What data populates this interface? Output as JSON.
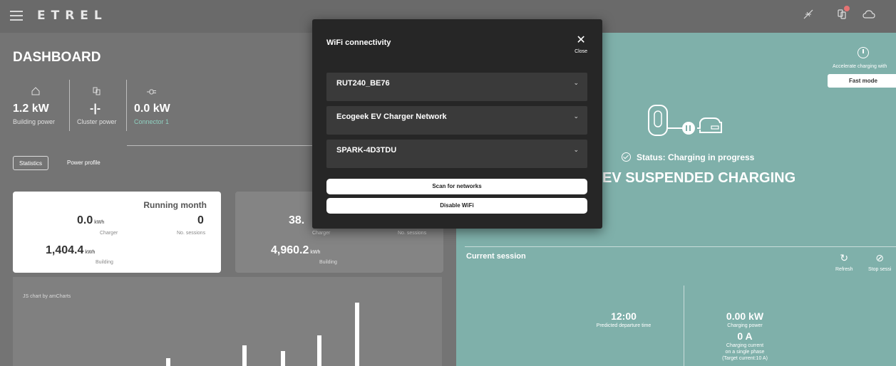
{
  "topbar": {
    "logo": "ETREL",
    "icons": [
      "menu-icon",
      "solar-off-icon",
      "cluster-icon",
      "cloud-icon"
    ]
  },
  "dashboard": {
    "title": "DASHBOARD",
    "power": [
      {
        "value": "1.2 kW",
        "label": "Building power",
        "icon": "home-icon"
      },
      {
        "value": "-|-",
        "label": "Cluster power",
        "icon": "cluster-icon"
      },
      {
        "value": "0.0 kW",
        "label": "Connector 1",
        "icon": "plug-icon"
      }
    ],
    "tabs": [
      "Statistics",
      "Power profile"
    ],
    "card_month": {
      "title": "Running month",
      "charger_value": "0.0",
      "charger_unit": "kWh",
      "charger_label": "Charger",
      "sessions_value": "0",
      "sessions_label": "No. sessions",
      "building_value": "1,404.4",
      "building_unit": "kWh",
      "building_label": "Building"
    },
    "card_other": {
      "charger_value": "38.",
      "charger_label": "Charger",
      "sessions_label": "No. sessions",
      "building_value": "4,960.2",
      "building_unit": "kWh",
      "building_label": "Building"
    },
    "chart_credit": "JS chart by amCharts"
  },
  "charger_panel": {
    "accelerate_label": "Accelerate charging with",
    "fast_mode": "Fast mode",
    "status": "Status: Charging in progress",
    "state_title": "EV SUSPENDED CHARGING",
    "current_session": "Current session",
    "refresh": "Refresh",
    "stop_session": "Stop sessi",
    "departure_value": "12:00",
    "departure_label": "Predicted departure time",
    "power_value": "0.00 kW",
    "power_label": "Charging power",
    "current_value": "0 A",
    "current_label_1": "Charging current",
    "current_label_2": "on a single phase",
    "current_label_3": "(Target current:10 A)"
  },
  "wifi_modal": {
    "title": "WiFi connectivity",
    "close": "Close",
    "networks": [
      "RUT240_BE76",
      "Ecogeek EV Charger Network",
      "SPARK-4D3TDU"
    ],
    "scan": "Scan for networks",
    "disable": "Disable WiFi"
  },
  "colors": {
    "background": "#747474",
    "panel_teal": "#7fb0aa",
    "modal_bg": "#262626",
    "network_row": "#3a3a3a",
    "connector_label": "#8fd0c0",
    "notification_dot": "#e57373"
  }
}
